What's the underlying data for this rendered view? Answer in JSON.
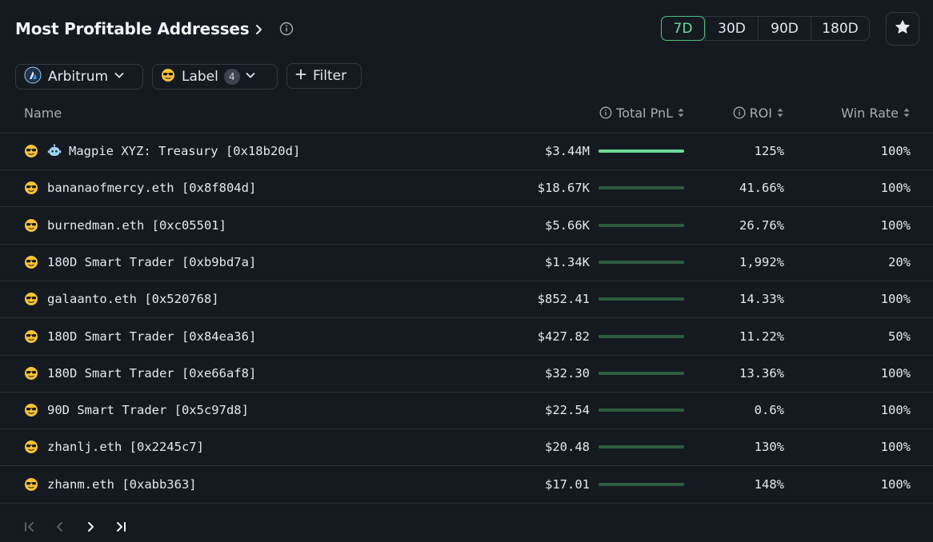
{
  "header": {
    "title": "Most Profitable Addresses"
  },
  "periods": [
    {
      "label": "7D",
      "active": true
    },
    {
      "label": "30D",
      "active": false
    },
    {
      "label": "90D",
      "active": false
    },
    {
      "label": "180D",
      "active": false
    }
  ],
  "filters": {
    "chain": "Arbitrum",
    "label": "Label",
    "label_count": "4",
    "filter": "Filter"
  },
  "columns": {
    "name": "Name",
    "pnl": "Total PnL",
    "roi": "ROI",
    "win_rate": "Win Rate"
  },
  "rows": [
    {
      "name": "Magpie XYZ: Treasury [0x18b20d]",
      "pnl": "$3.44M",
      "roi": "125%",
      "win_rate": "100%",
      "bot": true,
      "highlight": true,
      "pnl_fraction": 1.0
    },
    {
      "name": "bananaofmercy.eth [0x8f804d]",
      "pnl": "$18.67K",
      "roi": "41.66%",
      "win_rate": "100%",
      "pnl_fraction": 1.0
    },
    {
      "name": "burnedman.eth [0xc05501]",
      "pnl": "$5.66K",
      "roi": "26.76%",
      "win_rate": "100%",
      "pnl_fraction": 1.0
    },
    {
      "name": "180D Smart Trader [0xb9bd7a]",
      "pnl": "$1.34K",
      "roi": "1,992%",
      "win_rate": "20%",
      "pnl_fraction": 1.0
    },
    {
      "name": "galaanto.eth [0x520768]",
      "pnl": "$852.41",
      "roi": "14.33%",
      "win_rate": "100%",
      "pnl_fraction": 1.0
    },
    {
      "name": "180D Smart Trader [0x84ea36]",
      "pnl": "$427.82",
      "roi": "11.22%",
      "win_rate": "50%",
      "pnl_fraction": 1.0
    },
    {
      "name": "180D Smart Trader [0xe66af8]",
      "pnl": "$32.30",
      "roi": "13.36%",
      "win_rate": "100%",
      "pnl_fraction": 1.0
    },
    {
      "name": "90D Smart Trader [0x5c97d8]",
      "pnl": "$22.54",
      "roi": "0.6%",
      "win_rate": "100%",
      "pnl_fraction": 1.0
    },
    {
      "name": "zhanlj.eth [0x2245c7]",
      "pnl": "$20.48",
      "roi": "130%",
      "win_rate": "100%",
      "pnl_fraction": 1.0
    },
    {
      "name": "zhanm.eth [0xabb363]",
      "pnl": "$17.01",
      "roi": "148%",
      "win_rate": "100%",
      "pnl_fraction": 1.0
    }
  ],
  "icons": {
    "chevron": "chevron-right-icon",
    "info": "info-icon",
    "star": "star-icon",
    "chain": "arbitrum-logo-icon",
    "emoji": "sunglasses-emoji-icon",
    "bot": "robot-icon",
    "plus": "plus-icon",
    "sort": "sort-icon",
    "first": "first-page-icon",
    "prev": "prev-page-icon",
    "next": "next-page-icon",
    "last": "last-page-icon"
  },
  "colors": {
    "background": "#151a21",
    "accent_green": "#6fe09b",
    "bar_dim": "#2d5c3e",
    "bar_bright": "#6cd897"
  }
}
